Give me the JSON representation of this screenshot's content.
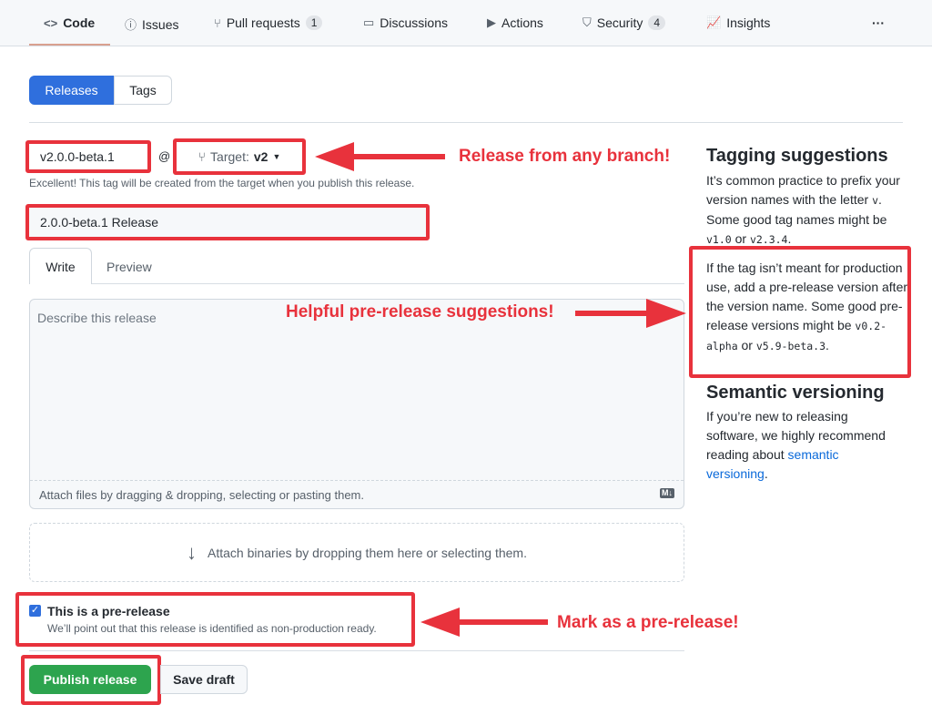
{
  "nav": {
    "items": [
      {
        "label": "Code",
        "icon": "code-icon"
      },
      {
        "label": "Issues",
        "icon": "issue-icon"
      },
      {
        "label": "Pull requests",
        "icon": "pull-request-icon",
        "count": "1"
      },
      {
        "label": "Discussions",
        "icon": "discussion-icon"
      },
      {
        "label": "Actions",
        "icon": "play-icon"
      },
      {
        "label": "Security",
        "icon": "shield-icon",
        "count": "4"
      },
      {
        "label": "Insights",
        "icon": "graph-icon"
      }
    ],
    "more": "···"
  },
  "tabs": {
    "releases": "Releases",
    "tags": "Tags"
  },
  "form": {
    "tag_value": "v2.0.0-beta.1",
    "at": "@",
    "target_label": "Target:",
    "target_value": "v2",
    "tag_hint": "Excellent! This tag will be created from the target when you publish this release.",
    "title_value": "2.0.0-beta.1 Release",
    "write_tab": "Write",
    "preview_tab": "Preview",
    "body_placeholder": "Describe this release",
    "attach_files": "Attach files by dragging & dropping, selecting or pasting them.",
    "markdown_badge": "M↓",
    "attach_binaries": "Attach binaries by dropping them here or selecting them.",
    "prerelease_label": "This is a pre-release",
    "prerelease_hint": "We’ll point out that this release is identified as non-production ready.",
    "prerelease_checked": true,
    "publish": "Publish release",
    "save_draft": "Save draft"
  },
  "sidebar": {
    "tagging_title": "Tagging suggestions",
    "tagging_p1": "It’s common practice to prefix your version names with the letter ",
    "tagging_v": "v",
    "tagging_p2": ". Some good tag names might be ",
    "tagging_c1": "v1.0",
    "tagging_or": " or ",
    "tagging_c2": "v2.3.4",
    "tagging_end": ".",
    "pre_p1": "If the tag isn’t meant for production use, add a pre-release version after the version name. Some good pre-release versions might be ",
    "pre_c1": "v0.2-alpha",
    "pre_or": " or ",
    "pre_c2": "v5.9-beta.3",
    "pre_end": ".",
    "semver_title": "Semantic versioning",
    "semver_p": "If you’re new to releasing software, we highly recommend reading about ",
    "semver_link": "semantic versioning",
    "semver_end": "."
  },
  "annotations": {
    "branch": "Release from any branch!",
    "prerelease_suggestions": "Helpful pre-release suggestions!",
    "mark_prerelease": "Mark as a pre-release!",
    "color": "#e8323c"
  }
}
